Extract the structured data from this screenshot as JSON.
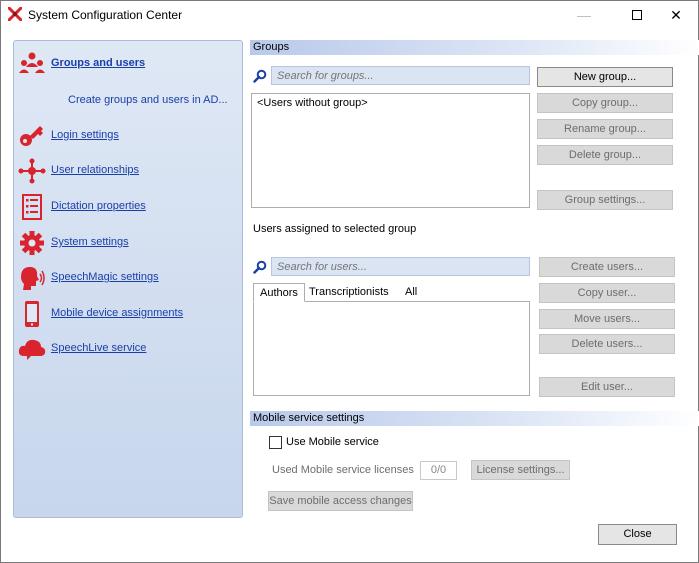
{
  "window": {
    "title": "System Configuration Center"
  },
  "sidebar": {
    "items": [
      {
        "label": "Groups and users",
        "icon": "users-group-icon"
      },
      {
        "label": "Login settings",
        "icon": "key-icon"
      },
      {
        "label": "User relationships",
        "icon": "network-icon"
      },
      {
        "label": "Dictation properties",
        "icon": "checklist-icon"
      },
      {
        "label": "System settings",
        "icon": "gear-icon"
      },
      {
        "label": "SpeechMagic settings",
        "icon": "speaking-head-icon"
      },
      {
        "label": "Mobile device assignments",
        "icon": "mobile-phone-icon"
      },
      {
        "label": "SpeechLive service",
        "icon": "cloud-icon"
      }
    ],
    "sub_link": "Create groups and users in AD..."
  },
  "groups": {
    "header": "Groups",
    "search_placeholder": "Search for groups...",
    "list": [
      "<Users without group>"
    ],
    "buttons": {
      "new": "New group...",
      "copy": "Copy group...",
      "rename": "Rename group...",
      "delete": "Delete group...",
      "settings": "Group settings..."
    }
  },
  "users": {
    "label": "Users assigned to selected group",
    "search_placeholder": "Search for users...",
    "tabs": [
      "Authors",
      "Transcriptionists",
      "All"
    ],
    "buttons": {
      "create": "Create users...",
      "copy": "Copy user...",
      "move": "Move users...",
      "delete": "Delete users...",
      "edit": "Edit user..."
    }
  },
  "mobile": {
    "header": "Mobile service settings",
    "use_label": "Use Mobile service",
    "use_checked": false,
    "licenses_label": "Used Mobile service licenses",
    "licenses_value": "0/0",
    "license_button": "License settings...",
    "save_button": "Save mobile access changes"
  },
  "footer": {
    "close": "Close"
  },
  "colors": {
    "accent_red": "#d9232d",
    "link_blue": "#1a3fa8",
    "header_blue": "#b9c9ea"
  }
}
